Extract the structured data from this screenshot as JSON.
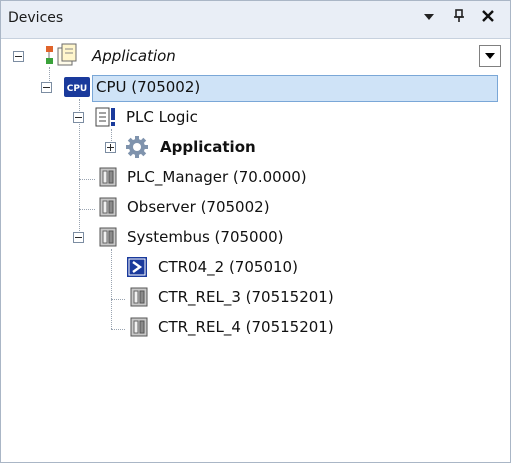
{
  "panel": {
    "title": "Devices",
    "pin_glyph": "❙",
    "close_glyph": "✕",
    "menu_glyph": "▾"
  },
  "tree": {
    "root": {
      "label": "Application",
      "icon": "application-tree-icon"
    },
    "cpu": {
      "label": "CPU (705002)",
      "icon": "cpu-icon",
      "selected": true
    },
    "plc_logic": {
      "label": "PLC Logic",
      "icon": "plc-logic-icon"
    },
    "app": {
      "label": "Application",
      "icon": "gear-icon"
    },
    "plc_manager": {
      "label": "PLC_Manager (70.0000)",
      "icon": "device-module-icon"
    },
    "observer": {
      "label": "Observer (705002)",
      "icon": "device-module-icon"
    },
    "systembus": {
      "label": "Systembus (705000)",
      "icon": "device-module-icon"
    },
    "ctr04": {
      "label": "CTR04_2 (705010)",
      "icon": "ctr-module-icon"
    },
    "ctr_rel_3": {
      "label": "CTR_REL_3 (70515201)",
      "icon": "device-module-icon"
    },
    "ctr_rel_4": {
      "label": "CTR_REL_4 (70515201)",
      "icon": "device-module-icon"
    }
  },
  "colors": {
    "selection_bg": "#cfe3f7",
    "selection_border": "#7aa7d7",
    "titlebar_bg": "#e9eef6",
    "cpu_blue": "#1a3a9c"
  }
}
